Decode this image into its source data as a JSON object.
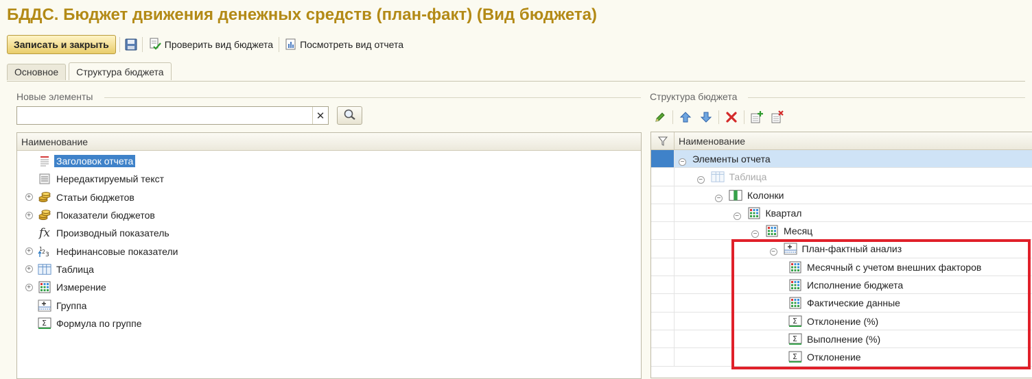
{
  "window": {
    "title": "БДДС. Бюджет движения денежных средств (план-факт) (Вид бюджета)"
  },
  "toolbar": {
    "save_close_label": "Записать и закрыть",
    "check_label": "Проверить вид бюджета",
    "view_report_label": "Посмотреть вид отчета"
  },
  "tabs": [
    {
      "label": "Основное",
      "active": false
    },
    {
      "label": "Структура бюджета",
      "active": true
    }
  ],
  "left_panel": {
    "group_title": "Новые элементы",
    "search": {
      "value": "",
      "placeholder": ""
    },
    "column_header": "Наименование",
    "items": [
      {
        "label": "Заголовок отчета",
        "icon": "report-header-icon",
        "expandable": false,
        "selected": true
      },
      {
        "label": "Нередактируемый текст",
        "icon": "text-block-icon",
        "expandable": false
      },
      {
        "label": "Статьи бюджетов",
        "icon": "coins-icon",
        "expandable": true
      },
      {
        "label": "Показатели бюджетов",
        "icon": "coins-icon",
        "expandable": true
      },
      {
        "label": "Производный показатель",
        "icon": "formula-fx-icon",
        "expandable": false
      },
      {
        "label": "Нефинансовые показатели",
        "icon": "numbers-icon",
        "expandable": true
      },
      {
        "label": "Таблица",
        "icon": "table-icon",
        "expandable": true
      },
      {
        "label": "Измерение",
        "icon": "dimension-grid-icon",
        "expandable": true
      },
      {
        "label": "Группа",
        "icon": "group-icon",
        "expandable": false
      },
      {
        "label": "Формула по группе",
        "icon": "sigma-icon",
        "expandable": false
      }
    ]
  },
  "right_panel": {
    "group_title": "Структура бюджета",
    "column_header": "Наименование",
    "rows": [
      {
        "label": "Элементы отчета",
        "level": 0,
        "icon": "",
        "collapsible": true,
        "selected": true,
        "muted": false
      },
      {
        "label": "Таблица",
        "level": 1,
        "icon": "table-icon",
        "collapsible": true,
        "muted": true
      },
      {
        "label": "Колонки",
        "level": 2,
        "icon": "columns-icon",
        "collapsible": true,
        "muted": false
      },
      {
        "label": "Квартал",
        "level": 3,
        "icon": "dimension-grid-icon",
        "collapsible": true,
        "muted": false
      },
      {
        "label": "Месяц",
        "level": 4,
        "icon": "dimension-grid-icon",
        "collapsible": true,
        "muted": false
      },
      {
        "label": "План-фактный анализ",
        "level": 5,
        "icon": "group-icon",
        "collapsible": true,
        "muted": false
      },
      {
        "label": "Месячный с учетом внешних факторов",
        "level": 6,
        "icon": "dimension-grid-icon",
        "collapsible": false,
        "muted": false
      },
      {
        "label": "Исполнение бюджета",
        "level": 6,
        "icon": "dimension-grid-icon",
        "collapsible": false,
        "muted": false
      },
      {
        "label": "Фактические данные",
        "level": 6,
        "icon": "dimension-grid-icon",
        "collapsible": false,
        "muted": false
      },
      {
        "label": "Отклонение (%)",
        "level": 6,
        "icon": "sigma-icon",
        "collapsible": false,
        "muted": false
      },
      {
        "label": "Выполнение (%)",
        "level": 6,
        "icon": "sigma-icon",
        "collapsible": false,
        "muted": false
      },
      {
        "label": "Отклонение",
        "level": 6,
        "icon": "sigma-icon",
        "collapsible": false,
        "muted": false
      }
    ]
  },
  "colors": {
    "title": "#b38a16",
    "selection": "#3f82c9",
    "highlight": "#e0202a"
  }
}
